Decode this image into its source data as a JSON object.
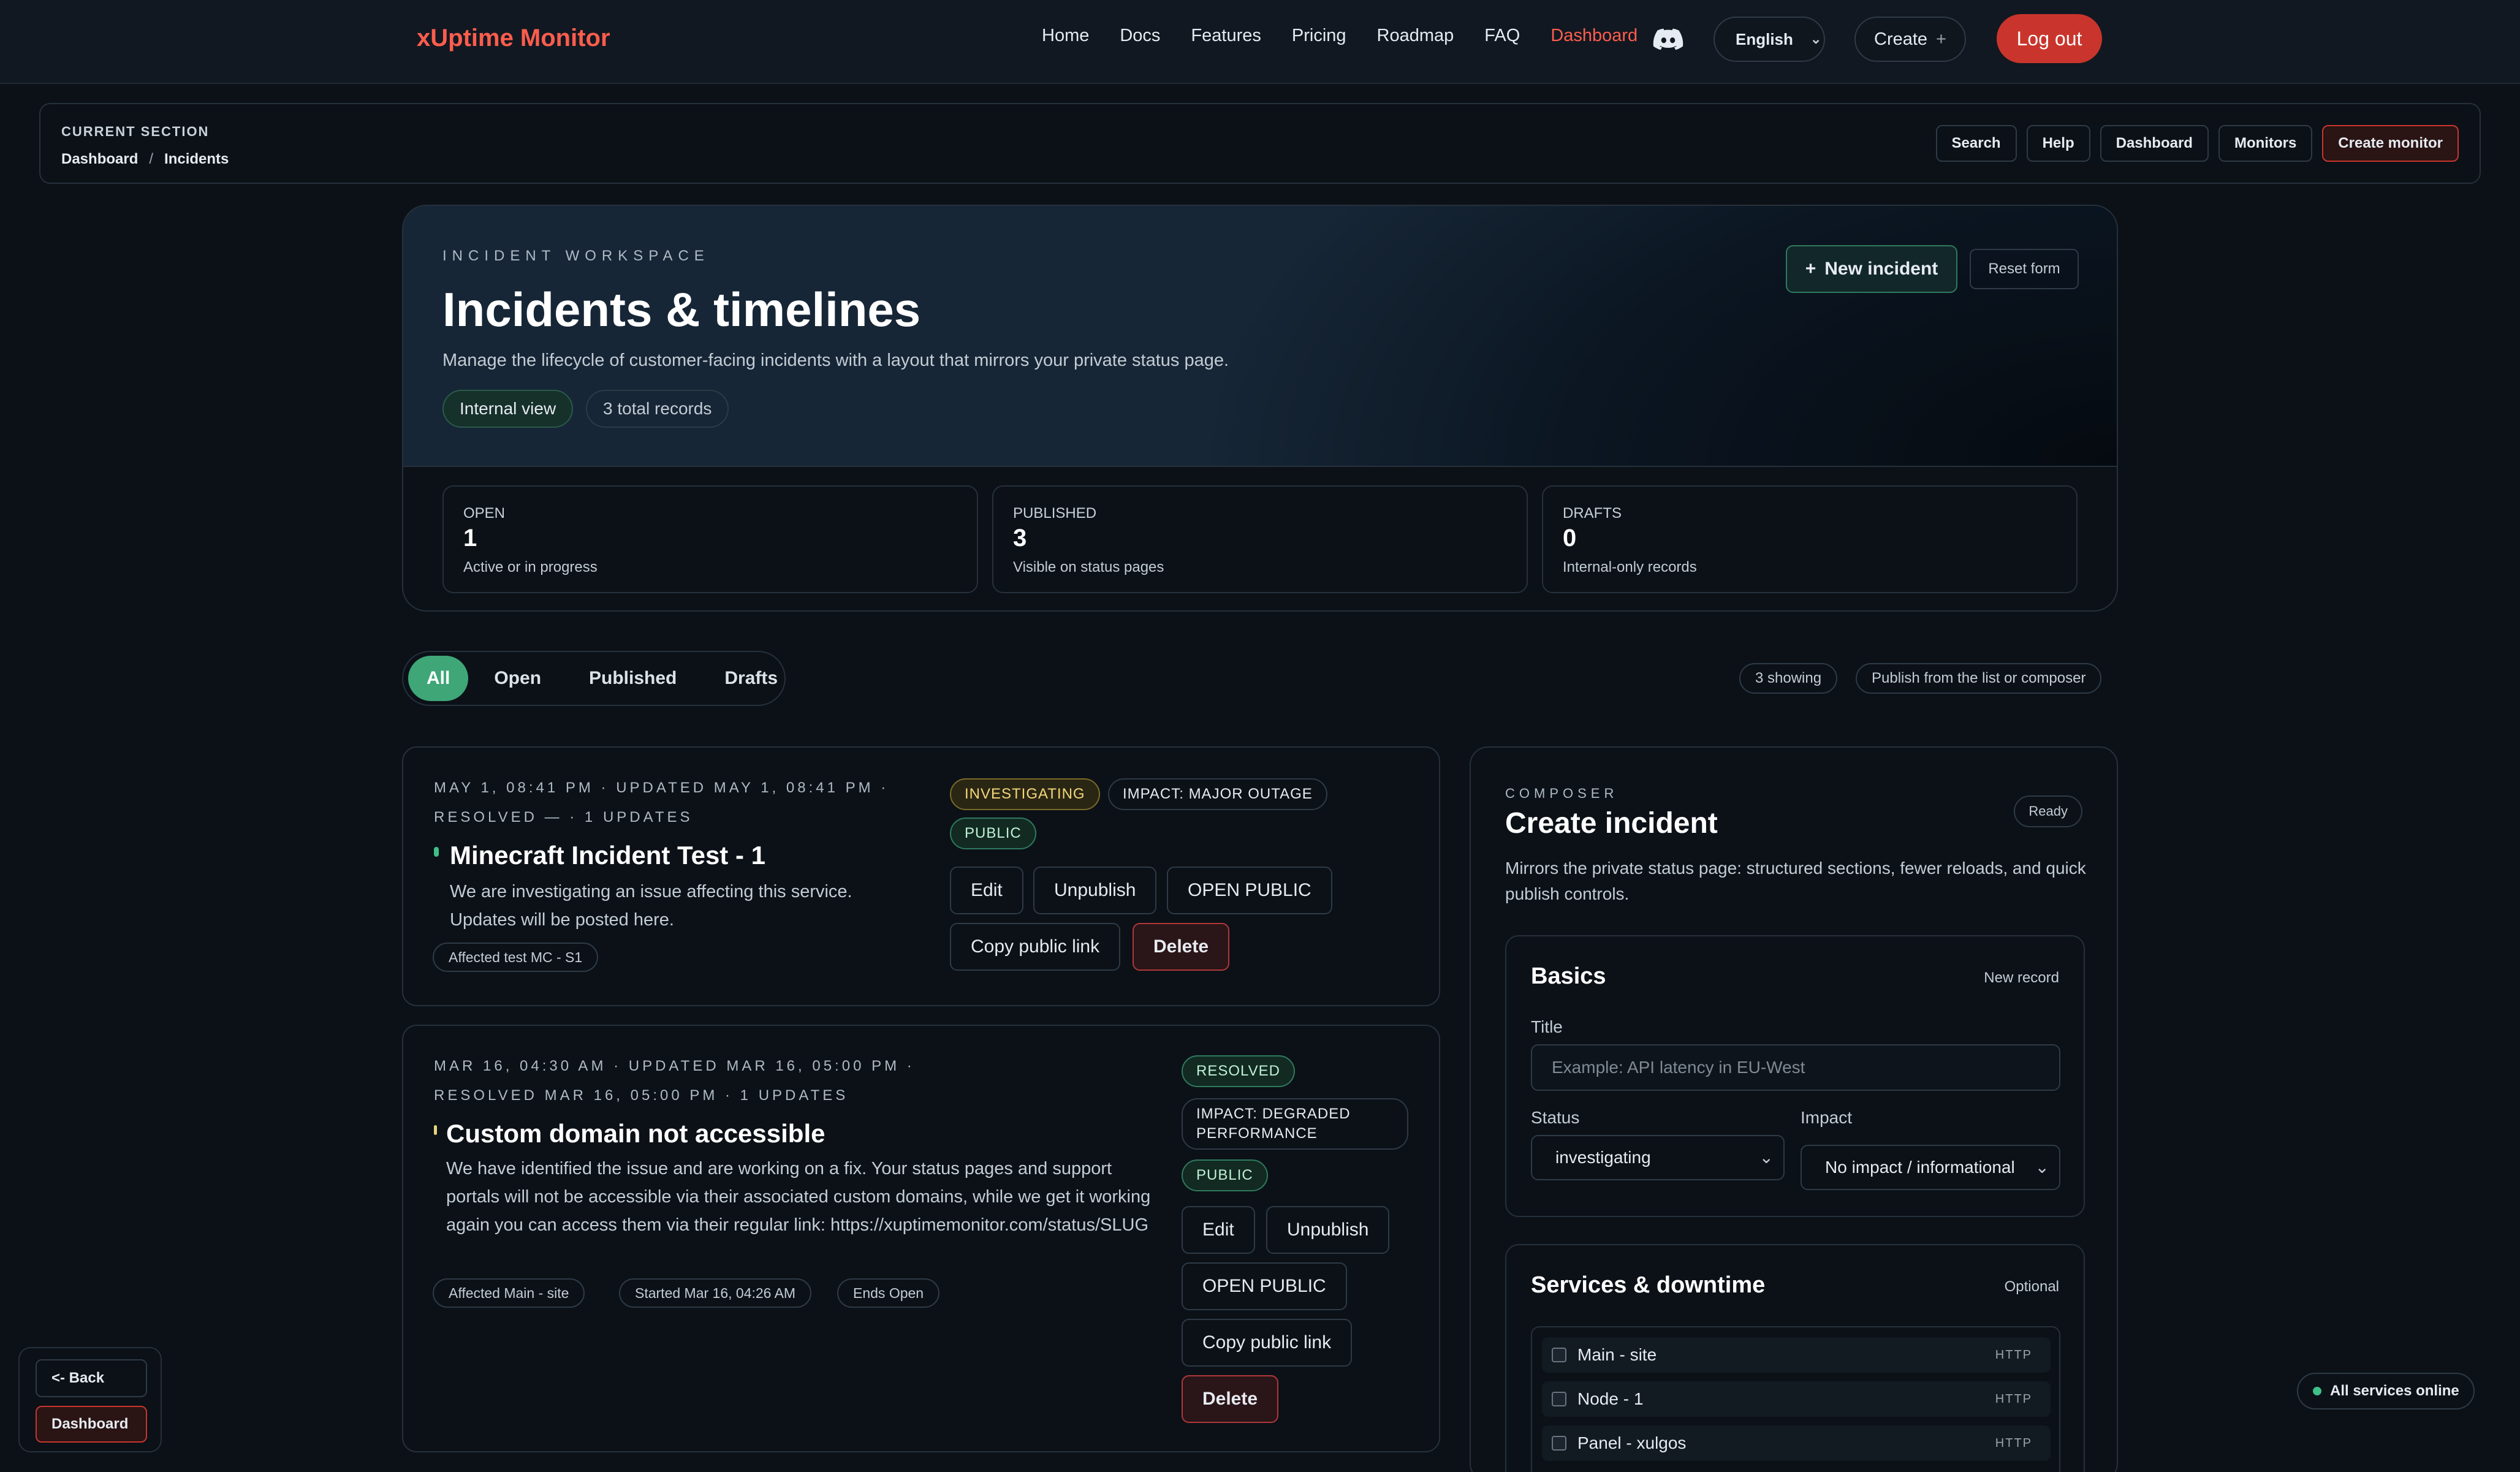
{
  "header": {
    "brand": "xUptime Monitor",
    "nav": [
      "Home",
      "Docs",
      "Features",
      "Pricing",
      "Roadmap",
      "FAQ",
      "Dashboard"
    ],
    "active_nav": "Dashboard",
    "language": "English",
    "create_label": "Create",
    "logout_label": "Log out"
  },
  "section": {
    "label": "CURRENT SECTION",
    "crumb_root": "Dashboard",
    "crumb_sep": "/",
    "crumb_current": "Incidents",
    "buttons": [
      "Search",
      "Help",
      "Dashboard",
      "Monitors",
      "Create monitor"
    ]
  },
  "hero": {
    "eyebrow": "INCIDENT WORKSPACE",
    "title": "Incidents & timelines",
    "lead": "Manage the lifecycle of customer-facing incidents with a layout that mirrors your private status page.",
    "view_pill": "Internal view",
    "records_pill": "3 total records",
    "new_incident": "New incident",
    "reset": "Reset form"
  },
  "stats": [
    {
      "label": "OPEN",
      "value": "1",
      "sub": "Active or in progress"
    },
    {
      "label": "PUBLISHED",
      "value": "3",
      "sub": "Visible on status pages"
    },
    {
      "label": "DRAFTS",
      "value": "0",
      "sub": "Internal-only records"
    }
  ],
  "filters": {
    "tabs": [
      "All",
      "Open",
      "Published",
      "Drafts"
    ],
    "active": "All",
    "showing": "3 showing",
    "publish_hint": "Publish from the list or composer"
  },
  "incidents": [
    {
      "meta_line1": "MAY 1, 08:41 PM  ·  UPDATED MAY 1, 08:41 PM  ·",
      "meta_line2": "RESOLVED —  ·  1 UPDATES",
      "title": "Minecraft Incident Test - 1",
      "desc": "We are investigating an issue affecting this service. Updates will be posted here.",
      "affected": "Affected  test MC - S1",
      "status": "INVESTIGATING",
      "impact": "IMPACT: MAJOR OUTAGE",
      "visibility": "PUBLIC",
      "actions": [
        "Edit",
        "Unpublish",
        "OPEN PUBLIC",
        "Copy public link",
        "Delete"
      ]
    },
    {
      "meta_line1": "MAR 16, 04:30 AM  ·  UPDATED MAR 16, 05:00 PM  ·",
      "meta_line2": "RESOLVED MAR 16, 05:00 PM  ·  1 UPDATES",
      "title": "Custom domain not accessible",
      "desc": "We have identified the issue and are working on a fix. Your status pages and support portals will not be accessible via their associated custom domains, while we get it working again you can access them via their regular link: https://xuptimemonitor.com/status/SLUG",
      "affected": "Affected  Main - site",
      "started": "Started Mar 16, 04:26 AM",
      "ends": "Ends Open",
      "status": "RESOLVED",
      "impact_line1": "IMPACT: DEGRADED",
      "impact_line2": "PERFORMANCE",
      "visibility": "PUBLIC",
      "actions": [
        "Edit",
        "Unpublish",
        "OPEN PUBLIC",
        "Copy public link",
        "Delete"
      ]
    }
  ],
  "composer": {
    "eyebrow": "COMPOSER",
    "title": "Create incident",
    "ready": "Ready",
    "desc": "Mirrors the private status page: structured sections, fewer reloads, and quick publish controls.",
    "basics": {
      "title": "Basics",
      "right": "New record",
      "title_label": "Title",
      "title_placeholder": "Example: API latency in EU-West",
      "status_label": "Status",
      "status_value": "investigating",
      "impact_label": "Impact",
      "impact_value": "No impact / informational"
    },
    "services": {
      "title": "Services & downtime",
      "right": "Optional",
      "items": [
        {
          "name": "Main - site",
          "kind": "HTTP"
        },
        {
          "name": "Node - 1",
          "kind": "HTTP"
        },
        {
          "name": "Panel - xulgos",
          "kind": "HTTP"
        }
      ]
    }
  },
  "footer": {
    "back": "<- Back",
    "dashboard": "Dashboard",
    "online": "All services online"
  },
  "colors": {
    "accent": "#ff5d4d",
    "success": "#3fa678",
    "danger": "#c9352c",
    "background": "#0b1117"
  }
}
